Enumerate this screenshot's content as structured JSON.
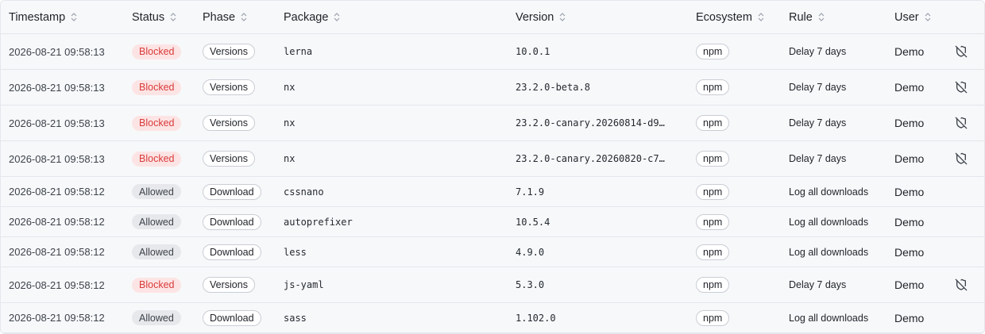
{
  "columns": {
    "timestamp": "Timestamp",
    "status": "Status",
    "phase": "Phase",
    "package": "Package",
    "version": "Version",
    "ecosystem": "Ecosystem",
    "rule": "Rule",
    "user": "User"
  },
  "icons": {
    "sort": "sort-chevrons-icon",
    "row_action": "shield-off-icon"
  },
  "colors": {
    "blocked_bg": "#fde4e4",
    "blocked_text": "#d93a3a",
    "allowed_bg": "#e7e8eb",
    "allowed_text": "#3d434b"
  },
  "rows": [
    {
      "timestamp": "2026-08-21 09:58:13",
      "status": "Blocked",
      "phase": "Versions",
      "package": "lerna",
      "version": "10.0.1",
      "ecosystem": "npm",
      "rule": "Delay 7 days",
      "user": "Demo",
      "has_action": true
    },
    {
      "timestamp": "2026-08-21 09:58:13",
      "status": "Blocked",
      "phase": "Versions",
      "package": "nx",
      "version": "23.2.0-beta.8",
      "ecosystem": "npm",
      "rule": "Delay 7 days",
      "user": "Demo",
      "has_action": true
    },
    {
      "timestamp": "2026-08-21 09:58:13",
      "status": "Blocked",
      "phase": "Versions",
      "package": "nx",
      "version": "23.2.0-canary.20260814-d9…",
      "ecosystem": "npm",
      "rule": "Delay 7 days",
      "user": "Demo",
      "has_action": true
    },
    {
      "timestamp": "2026-08-21 09:58:13",
      "status": "Blocked",
      "phase": "Versions",
      "package": "nx",
      "version": "23.2.0-canary.20260820-c7…",
      "ecosystem": "npm",
      "rule": "Delay 7 days",
      "user": "Demo",
      "has_action": true
    },
    {
      "timestamp": "2026-08-21 09:58:12",
      "status": "Allowed",
      "phase": "Download",
      "package": "cssnano",
      "version": "7.1.9",
      "ecosystem": "npm",
      "rule": "Log all downloads",
      "user": "Demo",
      "has_action": false
    },
    {
      "timestamp": "2026-08-21 09:58:12",
      "status": "Allowed",
      "phase": "Download",
      "package": "autoprefixer",
      "version": "10.5.4",
      "ecosystem": "npm",
      "rule": "Log all downloads",
      "user": "Demo",
      "has_action": false
    },
    {
      "timestamp": "2026-08-21 09:58:12",
      "status": "Allowed",
      "phase": "Download",
      "package": "less",
      "version": "4.9.0",
      "ecosystem": "npm",
      "rule": "Log all downloads",
      "user": "Demo",
      "has_action": false
    },
    {
      "timestamp": "2026-08-21 09:58:12",
      "status": "Blocked",
      "phase": "Versions",
      "package": "js-yaml",
      "version": "5.3.0",
      "ecosystem": "npm",
      "rule": "Delay 7 days",
      "user": "Demo",
      "has_action": true
    },
    {
      "timestamp": "2026-08-21 09:58:12",
      "status": "Allowed",
      "phase": "Download",
      "package": "sass",
      "version": "1.102.0",
      "ecosystem": "npm",
      "rule": "Log all downloads",
      "user": "Demo",
      "has_action": false
    }
  ]
}
